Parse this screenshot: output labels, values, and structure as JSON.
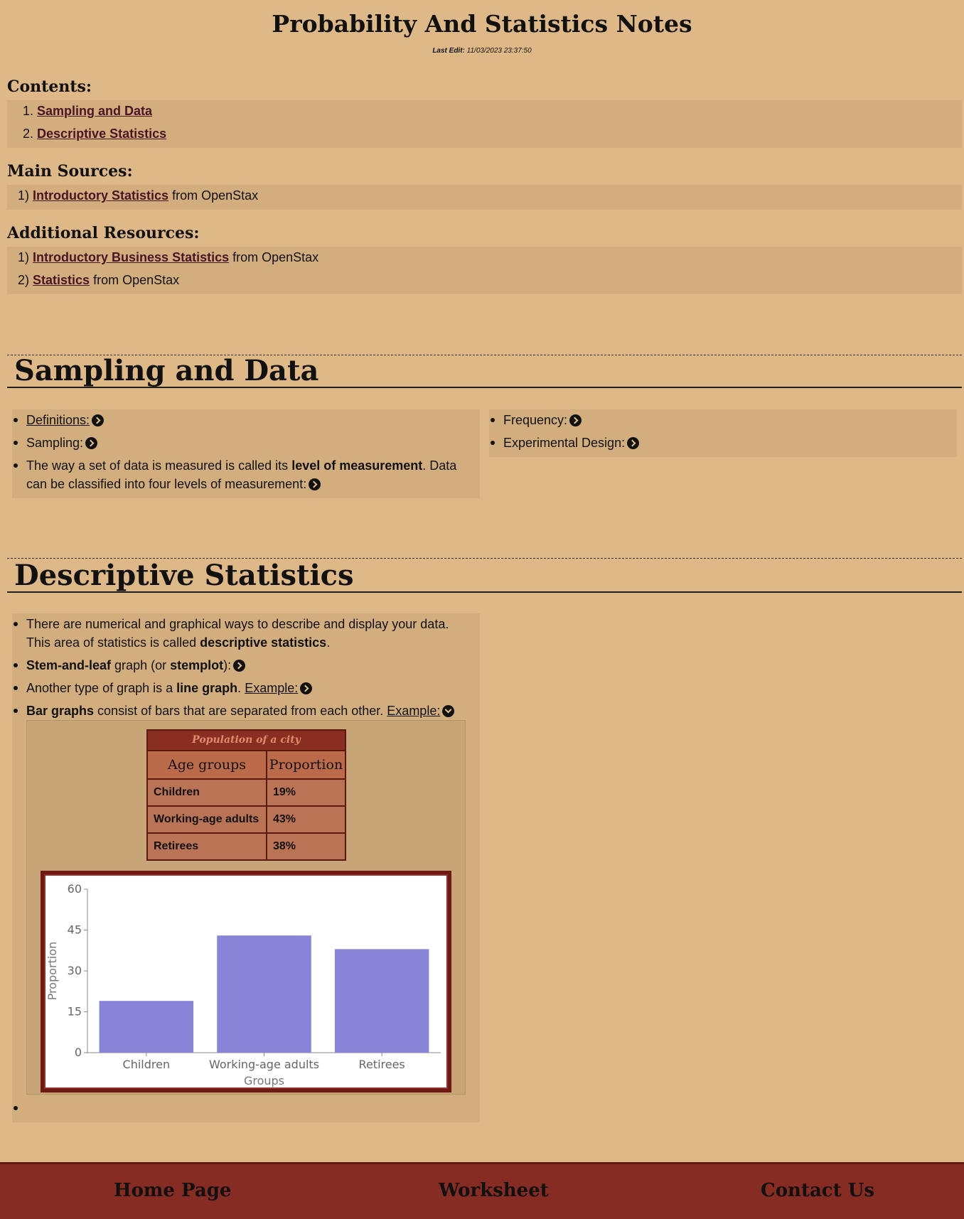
{
  "page": {
    "title": "Probability And Statistics Notes",
    "last_edit_label": "Last Edit:",
    "last_edit_value": "11/03/2023 23:37:50"
  },
  "contents": {
    "heading": "Contents:",
    "items": [
      {
        "num": "1.",
        "label": "Sampling and Data"
      },
      {
        "num": "2.",
        "label": "Descriptive Statistics"
      }
    ]
  },
  "main_sources": {
    "heading": "Main Sources:",
    "items": [
      {
        "num": "1)",
        "link": "Introductory Statistics",
        "suffix": "from OpenStax"
      }
    ]
  },
  "additional_resources": {
    "heading": "Additional Resources:",
    "items": [
      {
        "num": "1)",
        "link": "Introductory Business Statistics",
        "suffix": "from OpenStax"
      },
      {
        "num": "2)",
        "link": "Statistics",
        "suffix": "from OpenStax"
      }
    ]
  },
  "sampling": {
    "title": "Sampling and Data",
    "definitions": "Definitions:",
    "sampling": "Sampling:",
    "measure_pre": "The way a set of data is measured is called its",
    "measure_bold": "level of measurement",
    "measure_post": ". Data",
    "measure_line2": "can be classified into four levels of measurement:",
    "frequency": "Frequency:",
    "experimental": "Experimental Design:"
  },
  "descriptive": {
    "title": "Descriptive Statistics",
    "intro_line1": "There are numerical and graphical ways to describe and display your data.",
    "intro_line2_pre": "This area of statistics is called",
    "intro_line2_bold": "descriptive statistics",
    "intro_line2_post": ".",
    "stem_bold": "Stem-and-leaf",
    "stem_mid": "graph (or",
    "stem_bold2": "stemplot",
    "stem_post": "):",
    "line_pre": "Another type of graph is a",
    "line_bold": "line graph",
    "line_post": ".",
    "line_example": "Example:",
    "bar_bold": "Bar graphs",
    "bar_text": "consist of bars that are separated from each other.",
    "bar_example": "Example:"
  },
  "table": {
    "caption": "Population of a city",
    "headers": [
      "Age groups",
      "Proportion"
    ],
    "rows": [
      [
        "Children",
        "19%"
      ],
      [
        "Working-age adults",
        "43%"
      ],
      [
        "Retirees",
        "38%"
      ]
    ]
  },
  "chart_data": {
    "type": "bar",
    "categories": [
      "Children",
      "Working-age adults",
      "Retirees"
    ],
    "values": [
      19,
      43,
      38
    ],
    "xlabel": "Groups",
    "ylabel": "Proportion",
    "ylim": [
      0,
      60
    ],
    "yticks": [
      0,
      15,
      30,
      45,
      60
    ],
    "colors": {
      "bar": "#8884d8"
    }
  },
  "footer": {
    "home": "Home Page",
    "worksheet": "Worksheet",
    "contact": "Contact Us"
  },
  "colors": {
    "background": "#deb887",
    "panel": "#d2ae7e",
    "link": "#4a1424",
    "footer": "#862c22"
  }
}
